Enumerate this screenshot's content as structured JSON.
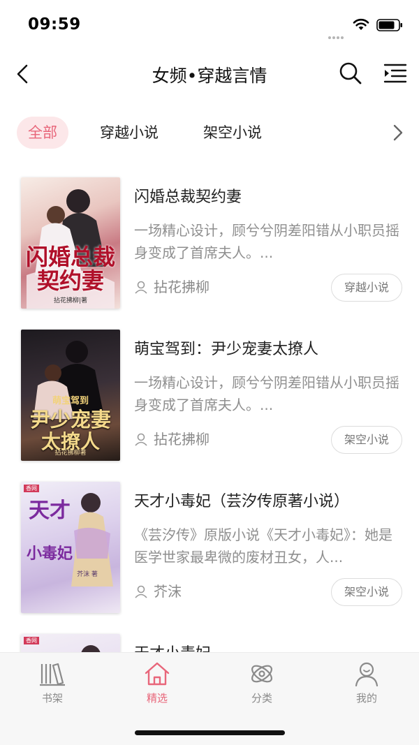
{
  "status_bar": {
    "time": "09:59"
  },
  "nav": {
    "title": "女频•穿越言情"
  },
  "categories": [
    {
      "label": "全部",
      "active": true
    },
    {
      "label": "穿越小说",
      "active": false
    },
    {
      "label": "架空小说",
      "active": false
    }
  ],
  "books": [
    {
      "title": "闪婚总裁契约妻",
      "description": "一场精心设计，顾兮兮阴差阳错从小职员摇身变成了首席夫人。...",
      "author": "拈花拂柳",
      "tag": "穿越小说",
      "cover": {
        "title_lines": [
          "闪婚总裁",
          "契约妻"
        ],
        "author_line": "拈花拂柳|著"
      }
    },
    {
      "title": "萌宝驾到：尹少宠妻太撩人",
      "description": "一场精心设计，顾兮兮阴差阳错从小职员摇身变成了首席夫人。...",
      "author": "拈花拂柳",
      "tag": "架空小说",
      "cover": {
        "title_lines": [
          "萌宝驾到",
          "尹少宠妻",
          "太撩人"
        ],
        "author_line": "拈花拂柳著"
      }
    },
    {
      "title": "天才小毒妃（芸汐传原著小说）",
      "description": "《芸汐传》原版小说《天才小毒妃》：她是医学世家最卑微的废材丑女，人...",
      "author": "芥沫",
      "tag": "架空小说",
      "cover": {
        "badge": "香网",
        "title_lines": [
          "天才",
          "小毒妃"
        ],
        "author_line": "芥沫 著"
      }
    },
    {
      "title": "天才小毒妃",
      "description": "",
      "author": "",
      "tag": "",
      "cover": {
        "badge": "香网",
        "title_lines": [],
        "author_line": ""
      }
    }
  ],
  "tab_bar": [
    {
      "label": "书架",
      "icon": "bookshelf-icon",
      "active": false
    },
    {
      "label": "精选",
      "icon": "home-icon",
      "active": true
    },
    {
      "label": "分类",
      "icon": "category-icon",
      "active": false
    },
    {
      "label": "我的",
      "icon": "profile-icon",
      "active": false
    }
  ],
  "colors": {
    "accent": "#e8667a",
    "accent_bg": "#fce7e9",
    "muted_text": "#8f8f8f",
    "tab_bar_bg": "#f7f7f7"
  }
}
